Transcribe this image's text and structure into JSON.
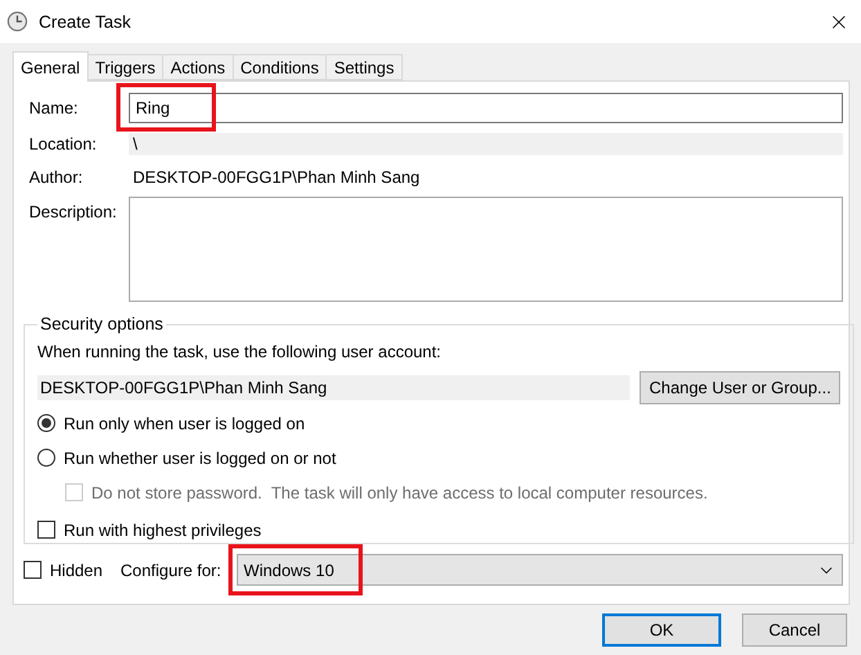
{
  "window": {
    "title": "Create Task"
  },
  "tabs": [
    {
      "label": "General",
      "selected": true
    },
    {
      "label": "Triggers",
      "selected": false
    },
    {
      "label": "Actions",
      "selected": false
    },
    {
      "label": "Conditions",
      "selected": false
    },
    {
      "label": "Settings",
      "selected": false
    }
  ],
  "name": {
    "label": "Name:",
    "value": "Ring",
    "highlighted": true
  },
  "location": {
    "label": "Location:",
    "value": "\\"
  },
  "author": {
    "label": "Author:",
    "value": "DESKTOP-00FGG1P\\Phan Minh Sang"
  },
  "description": {
    "label": "Description:"
  },
  "security": {
    "title": "Security options",
    "prompt": "When running the task, use the following user account:",
    "account": "DESKTOP-00FGG1P\\Phan Minh Sang",
    "change_button": "Change User or Group...",
    "options": [
      {
        "kind": "radio",
        "label": "Run only when user is logged on",
        "selected": true,
        "disabled": false,
        "indented": false
      },
      {
        "kind": "radio",
        "label": "Run whether user is logged on or not",
        "selected": false,
        "disabled": false,
        "indented": false
      },
      {
        "kind": "checkbox",
        "label": "Do not store password.  The task will only have access to local computer resources.",
        "checked": false,
        "disabled": true,
        "indented": true
      },
      {
        "kind": "checkbox",
        "label": "Run with highest privileges",
        "checked": false,
        "disabled": false,
        "indented": false
      }
    ]
  },
  "hidden": {
    "label": "Hidden",
    "checked": false
  },
  "configure": {
    "label": "Configure for:",
    "value": "Windows 10",
    "highlighted": true
  },
  "buttons": [
    {
      "label": "OK",
      "default": true
    },
    {
      "label": "Cancel",
      "default": false
    }
  ]
}
